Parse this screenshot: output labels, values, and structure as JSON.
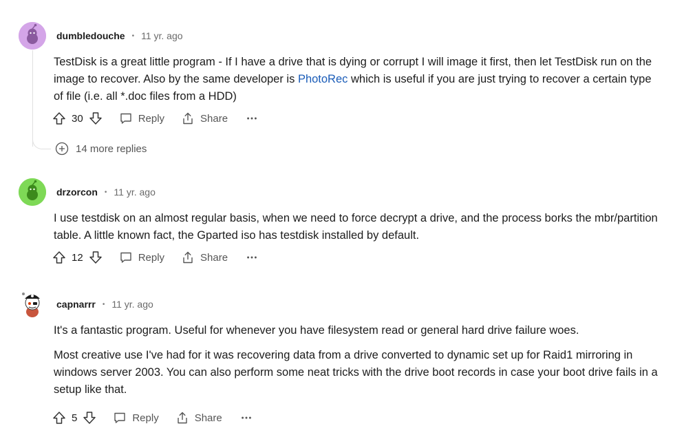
{
  "comments": [
    {
      "username": "dumbledouche",
      "separator": "•",
      "time": "11 yr. ago",
      "body_parts": {
        "before_link": "TestDisk is a great little program - If I have a drive that is dying or corrupt I will image it first, then let TestDisk run on the image to recover. Also by the same developer is ",
        "link": "PhotoRec",
        "after_link": " which is useful if you are just trying to recover a certain type of file (i.e. all *.doc files from a HDD)"
      },
      "votes": "30",
      "reply_label": "Reply",
      "share_label": "Share",
      "more_replies": "14 more replies"
    },
    {
      "username": "drzorcon",
      "separator": "•",
      "time": "11 yr. ago",
      "body": "I use testdisk on an almost regular basis, when we need to force decrypt a drive, and the process borks the mbr/partition table. A little known fact, the Gparted iso has testdisk installed by default.",
      "votes": "12",
      "reply_label": "Reply",
      "share_label": "Share"
    },
    {
      "username": "capnarrr",
      "separator": "•",
      "time": "11 yr. ago",
      "paragraphs": [
        "It's a fantastic program. Useful for whenever you have filesystem read or general hard drive failure woes.",
        "Most creative use I've had for it was recovering data from a drive converted to dynamic set up for Raid1 mirroring in windows server 2003. You can also perform some neat tricks with the drive boot records in case your boot drive fails in a setup like that."
      ],
      "votes": "5",
      "reply_label": "Reply",
      "share_label": "Share"
    }
  ],
  "colors": {
    "link": "#1a5cb8",
    "avatar_1": "#d4a5e8",
    "avatar_2": "#7ed956"
  }
}
